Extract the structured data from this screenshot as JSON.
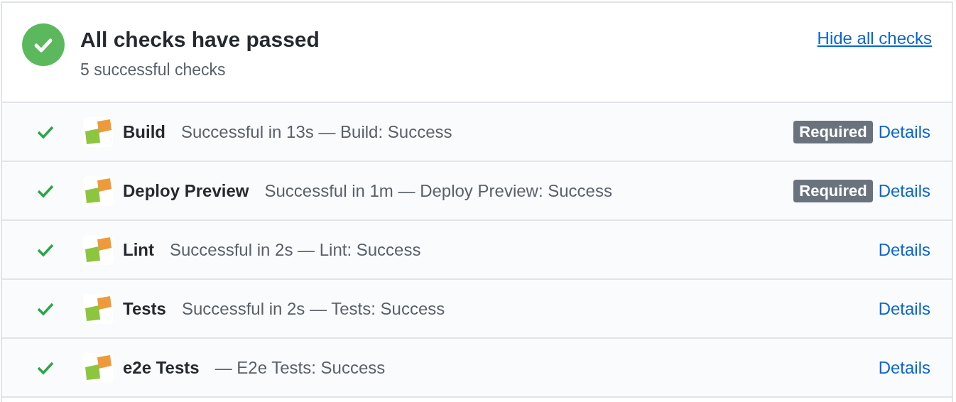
{
  "summary": {
    "title": "All checks have passed",
    "subtitle": "5 successful checks",
    "toggle_link": "Hide all checks"
  },
  "checks": [
    {
      "name": "Build",
      "description": "Successful in 13s — Build: Success",
      "required": true,
      "required_label": "Required",
      "details": "Details"
    },
    {
      "name": "Deploy Preview",
      "description": "Successful in 1m — Deploy Preview: Success",
      "required": true,
      "required_label": "Required",
      "details": "Details"
    },
    {
      "name": "Lint",
      "description": "Successful in 2s — Lint: Success",
      "required": false,
      "details": "Details"
    },
    {
      "name": "Tests",
      "description": "Successful in 2s — Tests: Success",
      "required": false,
      "details": "Details"
    },
    {
      "name": "e2e Tests",
      "description": "— E2e Tests: Success",
      "required": false,
      "details": "Details"
    }
  ]
}
